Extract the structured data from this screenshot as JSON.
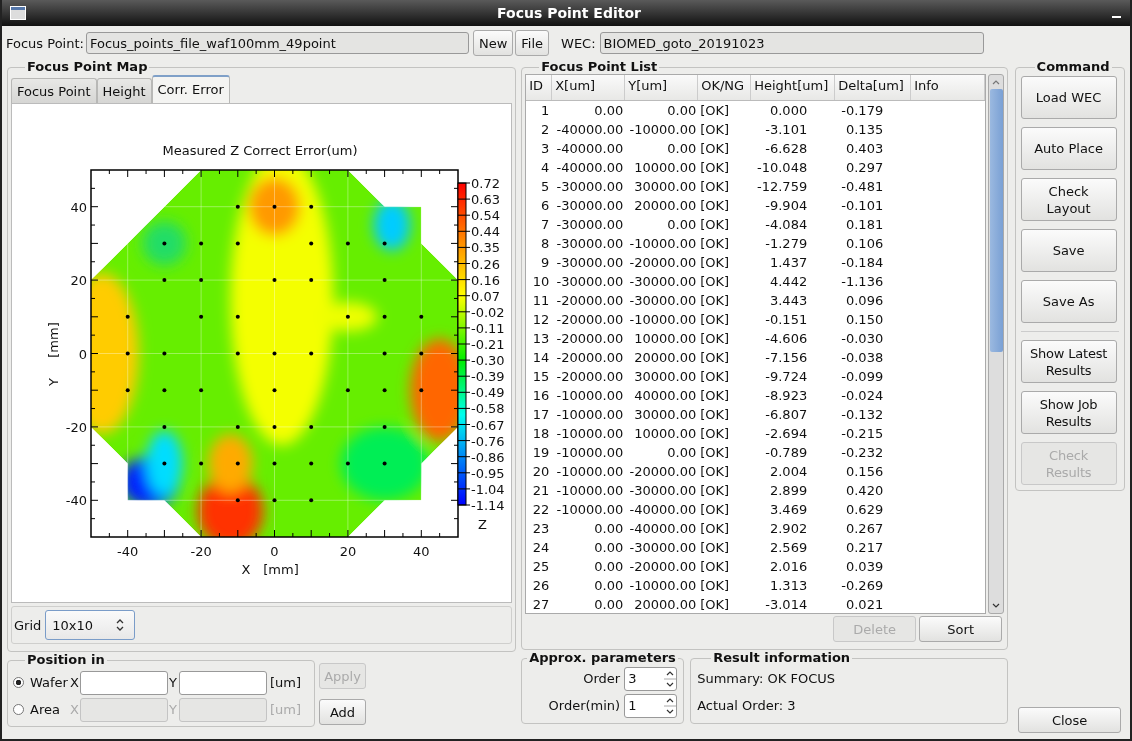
{
  "window": {
    "title": "Focus Point Editor"
  },
  "toolbar": {
    "focus_point_label": "Focus Point:",
    "focus_point_file": "Focus_points_file_waf100mm_49point",
    "buttons": [
      "New",
      "File"
    ],
    "wec_label": "WEC:",
    "wec_value": "BIOMED_goto_20191023"
  },
  "map_panel": {
    "title": "Focus Point Map",
    "tabs": [
      {
        "label": "Focus Point",
        "selected": false
      },
      {
        "label": "Height",
        "selected": false
      },
      {
        "label": "Corr. Error",
        "selected": true
      }
    ],
    "plot": {
      "title": "Measured Z Correct Error(um)",
      "x_ticks": [
        "-40",
        "-20",
        "0",
        "20",
        "40"
      ],
      "y_ticks": [
        "40",
        "20",
        "0",
        "-20",
        "-40"
      ],
      "x_label": "X",
      "x_unit": "[mm]",
      "y_label": "Y",
      "y_unit": "[mm]",
      "scale_ticks": [
        "0.72",
        "0.63",
        "0.54",
        "0.44",
        "0.35",
        "0.26",
        "0.16",
        "0.07",
        "-0.02",
        "-0.11",
        "-0.21",
        "-0.30",
        "-0.39",
        "-0.49",
        "-0.58",
        "-0.67",
        "-0.76",
        "-0.86",
        "-0.95",
        "-1.04",
        "-1.14"
      ],
      "scale_label": "Z"
    },
    "grid_label": "Grid",
    "grid_value": "10x10"
  },
  "position_panel": {
    "title": "Position in",
    "apply": {
      "label": "Apply",
      "disabled": true
    },
    "add": {
      "label": "Add",
      "disabled": false
    },
    "modes": [
      {
        "label": "Wafer",
        "selected": true,
        "x_label": "X",
        "y_label": "Y",
        "unit": "[um]",
        "disabled": false
      },
      {
        "label": "Area",
        "selected": false,
        "x_label": "X",
        "y_label": "Y",
        "unit": "[um]",
        "disabled": true
      }
    ]
  },
  "list_panel": {
    "title": "Focus Point List",
    "columns": [
      "ID",
      "X[um]",
      "Y[um]",
      "OK/NG",
      "Height[um]",
      "Delta[um]",
      "Info"
    ],
    "rows": [
      [
        "1",
        "0.00",
        "0.00",
        "[OK]",
        "0.000",
        "-0.179"
      ],
      [
        "2",
        "-40000.00",
        "-10000.00",
        "[OK]",
        "-3.101",
        "0.135"
      ],
      [
        "3",
        "-40000.00",
        "0.00",
        "[OK]",
        "-6.628",
        "0.403"
      ],
      [
        "4",
        "-40000.00",
        "10000.00",
        "[OK]",
        "-10.048",
        "0.297"
      ],
      [
        "5",
        "-30000.00",
        "30000.00",
        "[OK]",
        "-12.759",
        "-0.481"
      ],
      [
        "6",
        "-30000.00",
        "20000.00",
        "[OK]",
        "-9.904",
        "-0.101"
      ],
      [
        "7",
        "-30000.00",
        "0.00",
        "[OK]",
        "-4.084",
        "0.181"
      ],
      [
        "8",
        "-30000.00",
        "-10000.00",
        "[OK]",
        "-1.279",
        "0.106"
      ],
      [
        "9",
        "-30000.00",
        "-20000.00",
        "[OK]",
        "1.437",
        "-0.184"
      ],
      [
        "10",
        "-30000.00",
        "-30000.00",
        "[OK]",
        "4.442",
        "-1.136"
      ],
      [
        "11",
        "-20000.00",
        "-30000.00",
        "[OK]",
        "3.443",
        "0.096"
      ],
      [
        "12",
        "-20000.00",
        "-10000.00",
        "[OK]",
        "-0.151",
        "0.150"
      ],
      [
        "13",
        "-20000.00",
        "10000.00",
        "[OK]",
        "-4.606",
        "-0.030"
      ],
      [
        "14",
        "-20000.00",
        "20000.00",
        "[OK]",
        "-7.156",
        "-0.038"
      ],
      [
        "15",
        "-20000.00",
        "30000.00",
        "[OK]",
        "-9.724",
        "-0.099"
      ],
      [
        "16",
        "-10000.00",
        "40000.00",
        "[OK]",
        "-8.923",
        "-0.024"
      ],
      [
        "17",
        "-10000.00",
        "30000.00",
        "[OK]",
        "-6.807",
        "-0.132"
      ],
      [
        "18",
        "-10000.00",
        "10000.00",
        "[OK]",
        "-2.694",
        "-0.215"
      ],
      [
        "19",
        "-10000.00",
        "0.00",
        "[OK]",
        "-0.789",
        "-0.232"
      ],
      [
        "20",
        "-10000.00",
        "-20000.00",
        "[OK]",
        "2.004",
        "0.156"
      ],
      [
        "21",
        "-10000.00",
        "-30000.00",
        "[OK]",
        "2.899",
        "0.420"
      ],
      [
        "22",
        "-10000.00",
        "-40000.00",
        "[OK]",
        "3.469",
        "0.629"
      ],
      [
        "23",
        "0.00",
        "-40000.00",
        "[OK]",
        "2.902",
        "0.267"
      ],
      [
        "24",
        "0.00",
        "-30000.00",
        "[OK]",
        "2.569",
        "0.217"
      ],
      [
        "25",
        "0.00",
        "-20000.00",
        "[OK]",
        "2.016",
        "0.039"
      ],
      [
        "26",
        "0.00",
        "-10000.00",
        "[OK]",
        "1.313",
        "-0.269"
      ],
      [
        "27",
        "0.00",
        "20000.00",
        "[OK]",
        "-3.014",
        "0.021"
      ]
    ],
    "buttons": [
      {
        "label": "Delete",
        "disabled": true
      },
      {
        "label": "Sort",
        "disabled": false
      }
    ]
  },
  "approx_panel": {
    "title": "Approx. parameters",
    "fields": [
      {
        "label": "Order",
        "value": "3"
      },
      {
        "label": "Order(min)",
        "value": "1"
      }
    ]
  },
  "result_panel": {
    "title": "Result information",
    "lines": [
      "Summary: OK FOCUS",
      "Actual Order: 3"
    ]
  },
  "command_panel": {
    "title": "Command",
    "groups": [
      [
        {
          "label": "Load WEC",
          "disabled": false
        },
        {
          "label": "Auto Place",
          "disabled": false
        },
        {
          "label": "Check Layout",
          "disabled": false
        },
        {
          "label": "Save",
          "disabled": false
        },
        {
          "label": "Save As",
          "disabled": false
        }
      ],
      [
        {
          "label": "Show Latest Results",
          "disabled": false
        },
        {
          "label": "Show Job Results",
          "disabled": false
        },
        {
          "label": "Check Results",
          "disabled": true
        }
      ]
    ],
    "close": "Close"
  }
}
